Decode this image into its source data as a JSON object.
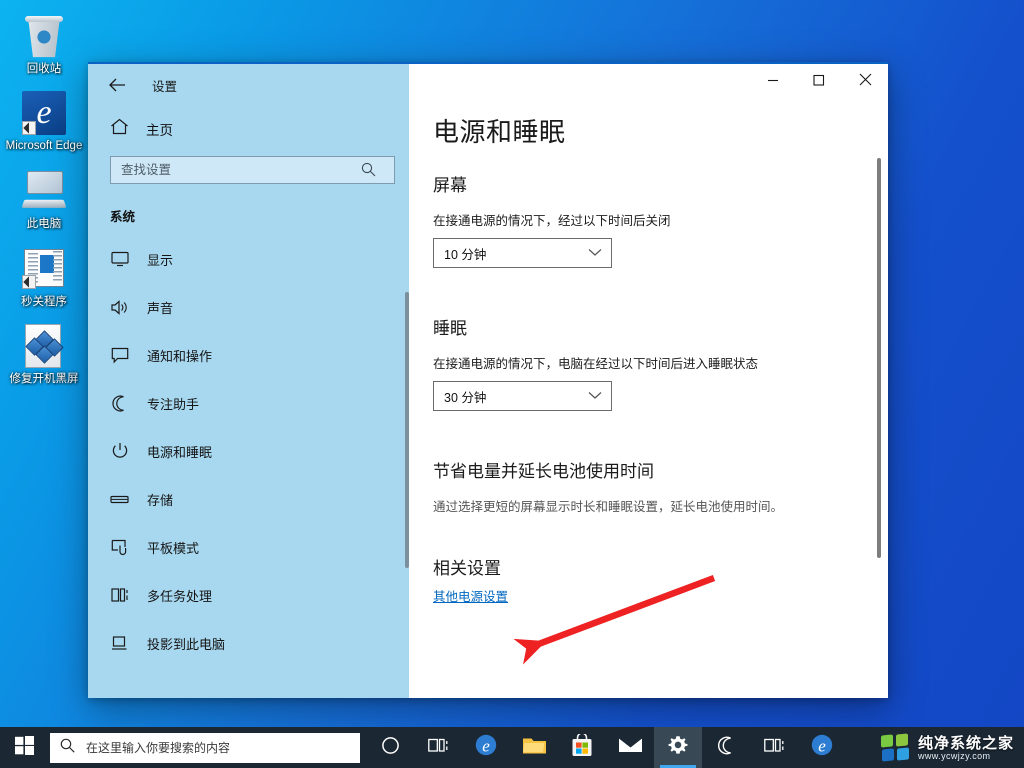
{
  "desktop": {
    "icons": [
      {
        "label": "回收站",
        "icon": "recycle-bin-icon"
      },
      {
        "label": "Microsoft Edge",
        "icon": "edge-icon"
      },
      {
        "label": "此电脑",
        "icon": "this-pc-icon"
      },
      {
        "label": "秒关程序",
        "icon": "app-window-icon"
      },
      {
        "label": "修复开机黑屏",
        "icon": "file-blocks-icon"
      }
    ]
  },
  "window": {
    "title": "设置",
    "back_icon": "back-arrow-icon",
    "minimize_label": "—",
    "maximize_label": "□",
    "close_label": "✕",
    "accent_color": "#0a62c4"
  },
  "sidebar": {
    "home_label": "主页",
    "home_icon": "home-icon",
    "search": {
      "placeholder": "查找设置",
      "value": "",
      "icon": "search-icon"
    },
    "group_title": "系统",
    "items": [
      {
        "label": "显示",
        "icon": "monitor-icon"
      },
      {
        "label": "声音",
        "icon": "speaker-icon"
      },
      {
        "label": "通知和操作",
        "icon": "notification-icon"
      },
      {
        "label": "专注助手",
        "icon": "moon-icon"
      },
      {
        "label": "电源和睡眠",
        "icon": "power-icon"
      },
      {
        "label": "存储",
        "icon": "storage-icon"
      },
      {
        "label": "平板模式",
        "icon": "tablet-icon"
      },
      {
        "label": "多任务处理",
        "icon": "multitask-icon"
      },
      {
        "label": "投影到此电脑",
        "icon": "project-icon"
      }
    ]
  },
  "main": {
    "page_title": "电源和睡眠",
    "screen_section": {
      "heading": "屏幕",
      "description": "在接通电源的情况下，经过以下时间后关闭",
      "dropdown_value": "10 分钟"
    },
    "sleep_section": {
      "heading": "睡眠",
      "description": "在接通电源的情况下，电脑在经过以下时间后进入睡眠状态",
      "dropdown_value": "30 分钟"
    },
    "battery_section": {
      "heading": "节省电量并延长电池使用时间",
      "description": "通过选择更短的屏幕显示时长和睡眠设置，延长电池使用时间。"
    },
    "related_section": {
      "heading": "相关设置",
      "link_label": "其他电源设置",
      "link_color": "#0067c0"
    }
  },
  "annotation": {
    "color": "#ee2222",
    "type": "arrow",
    "points_to": "其他电源设置"
  },
  "taskbar": {
    "start_icon": "windows-logo-icon",
    "search_placeholder": "在这里输入你要搜索的内容",
    "search_icon": "search-icon",
    "buttons": [
      {
        "icon": "cortana-circle-icon",
        "active": false
      },
      {
        "icon": "task-view-icon",
        "active": false
      },
      {
        "icon": "edge-icon",
        "active": false
      },
      {
        "icon": "file-explorer-icon",
        "active": false
      },
      {
        "icon": "microsoft-store-icon",
        "active": false
      },
      {
        "icon": "mail-icon",
        "active": false
      },
      {
        "icon": "settings-gear-icon",
        "active": true
      },
      {
        "icon": "crescent-moon-icon",
        "active": false
      },
      {
        "icon": "task-view-icon",
        "active": false
      },
      {
        "icon": "edge-icon",
        "active": false
      }
    ]
  },
  "watermark": {
    "title": "纯净系统之家",
    "url": "www.ycwjzy.com"
  }
}
